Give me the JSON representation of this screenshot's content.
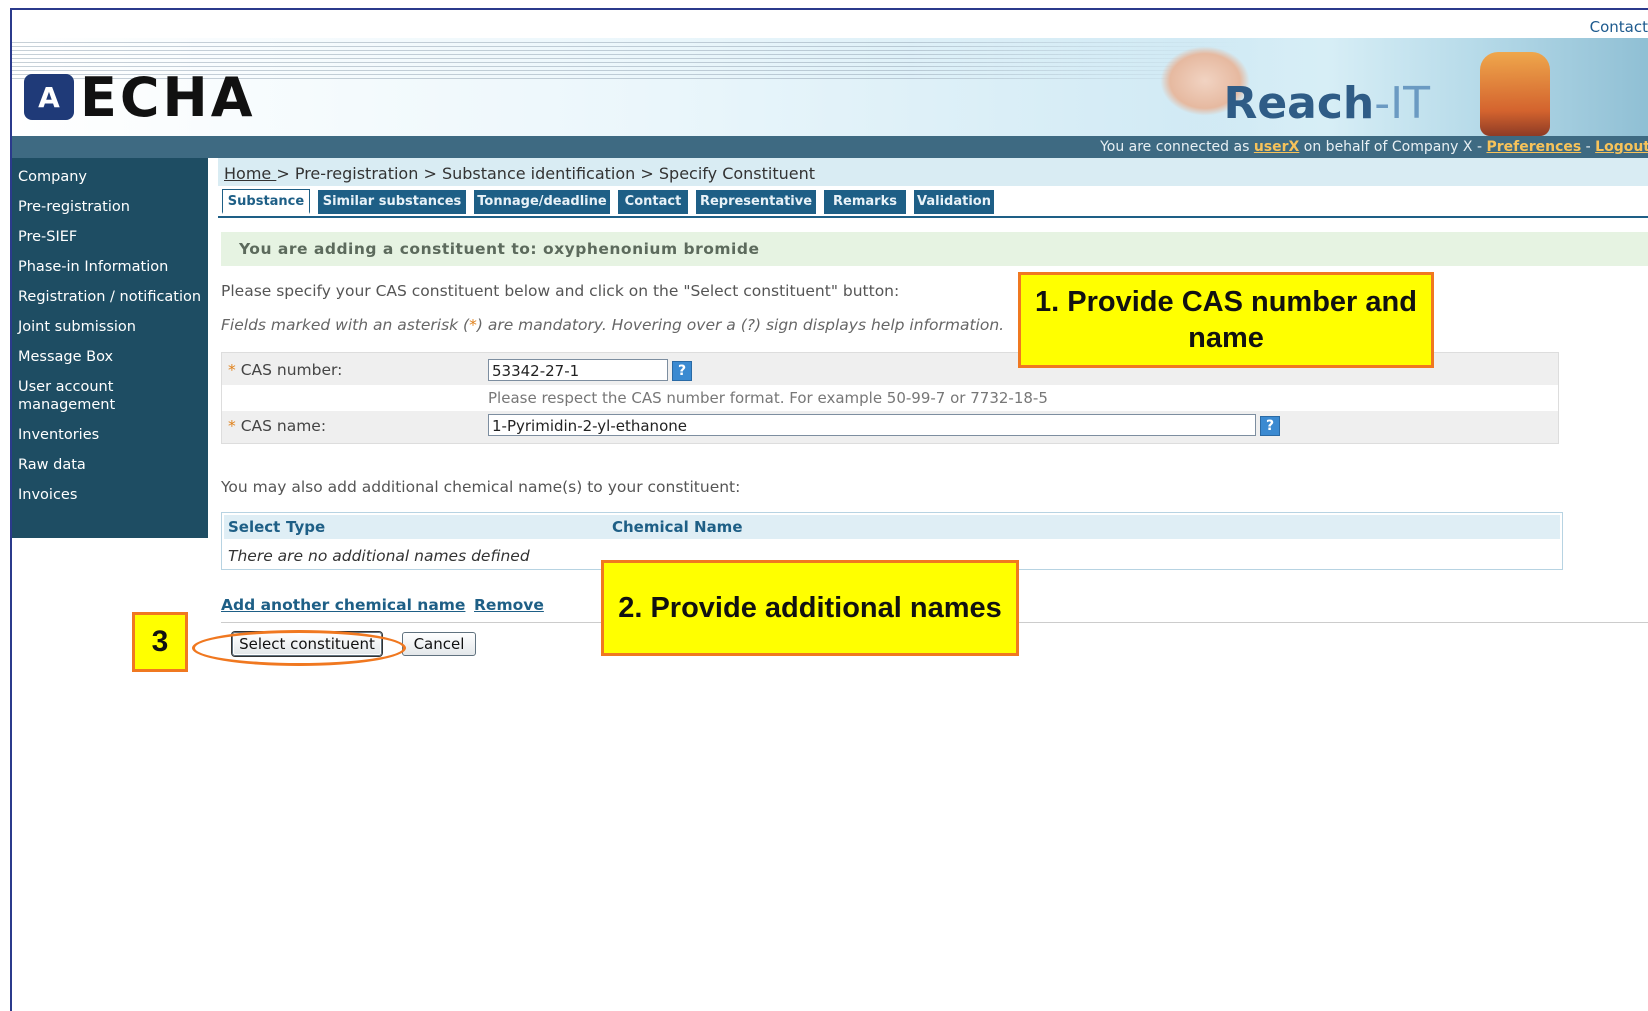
{
  "header": {
    "contact_link": "Contact",
    "logo_text": "ECHA",
    "logo_emblem": "emblem",
    "product_name_main": "Reach",
    "product_name_suffix": "-IT",
    "connected_prefix": "You are connected as ",
    "user": "userX",
    "behalf_text": " on behalf of Company X - ",
    "preferences": "Preferences",
    "separator": " - ",
    "logout": "Logout"
  },
  "sidebar": {
    "items": [
      {
        "label": "Company"
      },
      {
        "label": "Pre-registration"
      },
      {
        "label": "Pre-SIEF"
      },
      {
        "label": "Phase-in Information"
      },
      {
        "label": "Registration / notification"
      },
      {
        "label": "Joint submission"
      },
      {
        "label": "Message Box"
      },
      {
        "label": "User account management"
      },
      {
        "label": "Inventories"
      },
      {
        "label": "Raw data"
      },
      {
        "label": "Invoices"
      }
    ]
  },
  "breadcrumb": {
    "home": "Home ",
    "rest": "> Pre-registration > Substance identification > Specify Constituent"
  },
  "tabs": [
    {
      "label": "Substance",
      "active": true
    },
    {
      "label": "Similar substances",
      "active": false
    },
    {
      "label": "Tonnage/deadline",
      "active": false
    },
    {
      "label": "Contact",
      "active": false
    },
    {
      "label": "Representative",
      "active": false
    },
    {
      "label": "Remarks",
      "active": false
    },
    {
      "label": "Validation",
      "active": false
    }
  ],
  "main": {
    "info": "You are adding a constituent to: oxyphenonium bromide",
    "instruction": "Please specify your CAS constituent below and click on the \"Select constituent\" button:",
    "mandatory_prefix": "Fields marked with an asterisk (",
    "mandatory_star": "*",
    "mandatory_suffix": ") are mandatory. Hovering over a (?) sign displays help information.",
    "help_glyph": "?",
    "cas_number_label": "CAS number:",
    "cas_number_value": "53342-27-1",
    "cas_hint": "Please respect the CAS number format. For example 50-99-7 or 7732-18-5",
    "cas_name_label": "CAS name:",
    "cas_name_value": "1-Pyrimidin-2-yl-ethanone",
    "additional_intro": "You may also add additional chemical name(s) to your constituent:",
    "table_headers": {
      "select": "Select",
      "type": "Type",
      "chemical_name": "Chemical Name"
    },
    "table_empty": "There are no additional names defined",
    "add_link": "Add another chemical name",
    "remove_link": "Remove",
    "select_button": "Select constituent",
    "cancel_button": "Cancel"
  },
  "annotations": {
    "callout1": "1. Provide CAS number and name",
    "callout2": "2. Provide additional names",
    "callout3": "3",
    "color_fill": "#ffff00",
    "color_border": "#f07820"
  }
}
